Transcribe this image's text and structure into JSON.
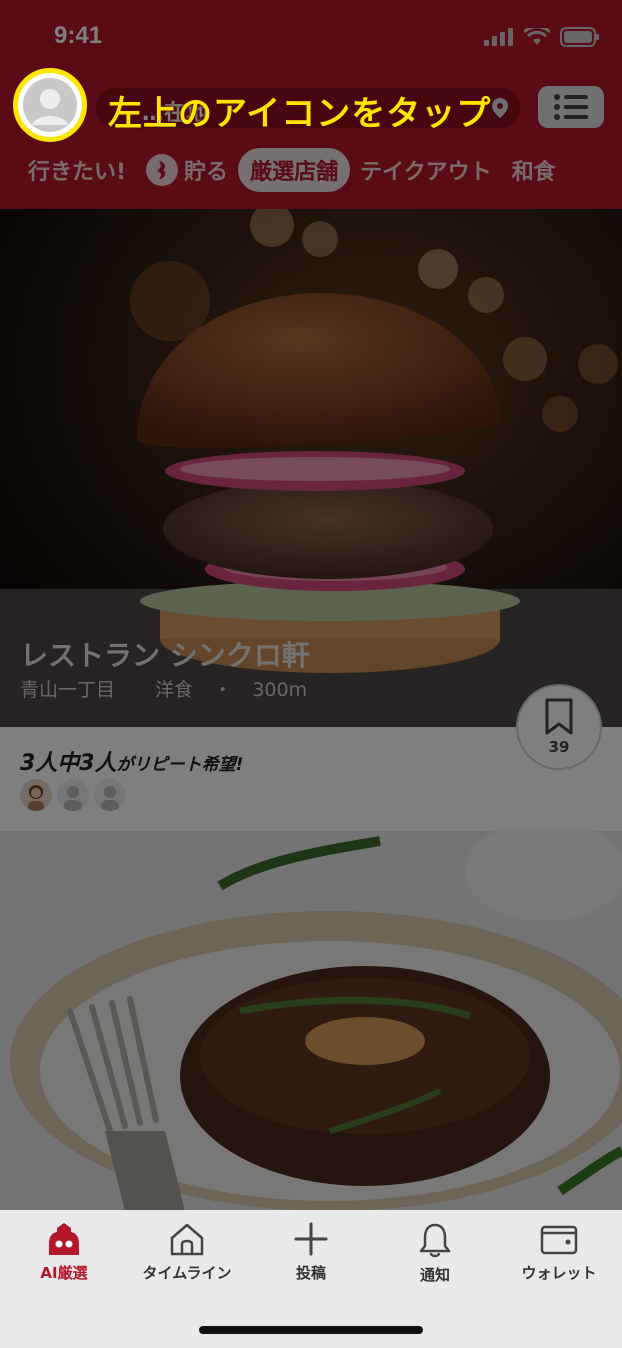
{
  "status_bar": {
    "time": "9:41"
  },
  "header": {
    "search_text": "…在地",
    "categories": [
      {
        "label": "行きたい!",
        "active": false
      },
      {
        "label": "貯る",
        "active": false
      },
      {
        "label": "厳選店舗",
        "active": true
      },
      {
        "label": "テイクアウト",
        "active": false
      },
      {
        "label": "和食",
        "active": false
      }
    ]
  },
  "callout": {
    "text": "左上のアイコンをタップ"
  },
  "restaurant": {
    "name": "レストラン シンクロ軒",
    "area": "青山一丁目",
    "genre": "洋食",
    "separator": "・",
    "distance": "300m",
    "bookmark_count": "39",
    "repeat": {
      "prefix": "3人中3人",
      "suffix": "がリピート希望!"
    }
  },
  "tabbar": {
    "tabs": [
      {
        "label": "AI厳選",
        "icon": "ai-robot-icon",
        "active": true
      },
      {
        "label": "タイムライン",
        "icon": "home-icon",
        "active": false
      },
      {
        "label": "投稿",
        "icon": "plus-icon",
        "active": false
      },
      {
        "label": "通知",
        "icon": "bell-icon",
        "active": false
      },
      {
        "label": "ウォレット",
        "icon": "wallet-icon",
        "active": false
      }
    ]
  },
  "colors": {
    "brand": "#b4172a",
    "highlight": "#ffe600"
  }
}
